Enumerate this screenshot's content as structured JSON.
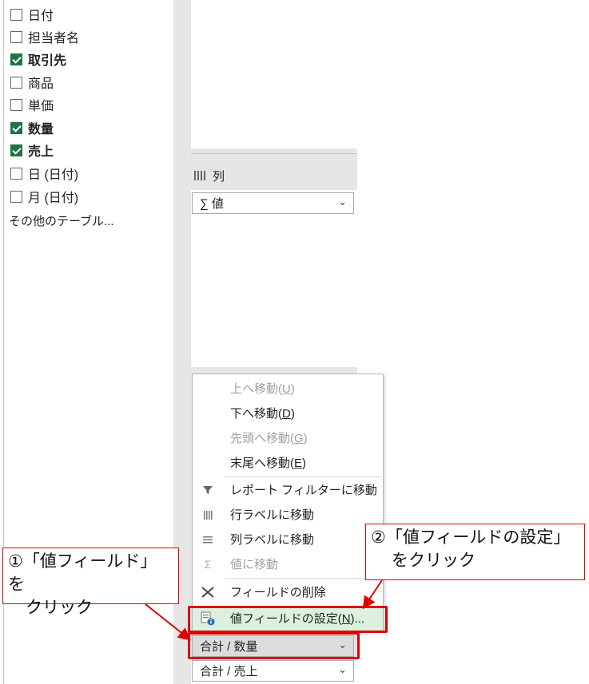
{
  "fields": [
    {
      "label": "日付",
      "checked": false
    },
    {
      "label": "担当者名",
      "checked": false
    },
    {
      "label": "取引先",
      "checked": true
    },
    {
      "label": "商品",
      "checked": false
    },
    {
      "label": "単価",
      "checked": false
    },
    {
      "label": "数量",
      "checked": true
    },
    {
      "label": "売上",
      "checked": true
    },
    {
      "label": "日 (日付)",
      "checked": false
    },
    {
      "label": "月 (日付)",
      "checked": false
    }
  ],
  "more_tables": "その他のテーブル...",
  "columns_area": {
    "title": "列",
    "item": "∑ 値"
  },
  "values_area": {
    "item1": "合計 / 数量",
    "item2": "合計 / 売上"
  },
  "context_menu": {
    "move_up": {
      "label": "上へ移動(",
      "key": "U",
      "end": ")"
    },
    "move_down": {
      "label": "下へ移動(",
      "key": "D",
      "end": ")"
    },
    "move_to_top": {
      "label": "先頭へ移動(",
      "key": "G",
      "end": ")"
    },
    "move_to_end": {
      "label": "末尾へ移動(",
      "key": "E",
      "end": ")"
    },
    "move_to_report_filter": "レポート フィルターに移動",
    "move_to_row_labels": "行ラベルに移動",
    "move_to_column_labels": "列ラベルに移動",
    "move_to_values": "値に移動",
    "remove_field": "フィールドの削除",
    "value_field_settings": {
      "label": "値フィールドの設定(",
      "key": "N",
      "end": ")..."
    }
  },
  "annotations": {
    "step1_line1": "①「値フィールド」を",
    "step1_line2": "クリック",
    "step2_line1": "②「値フィールドの設定」",
    "step2_line2": "をクリック",
    "annotation_color": "#e00000"
  },
  "highlight_color": "#dbf0df",
  "check_color": "#217346"
}
